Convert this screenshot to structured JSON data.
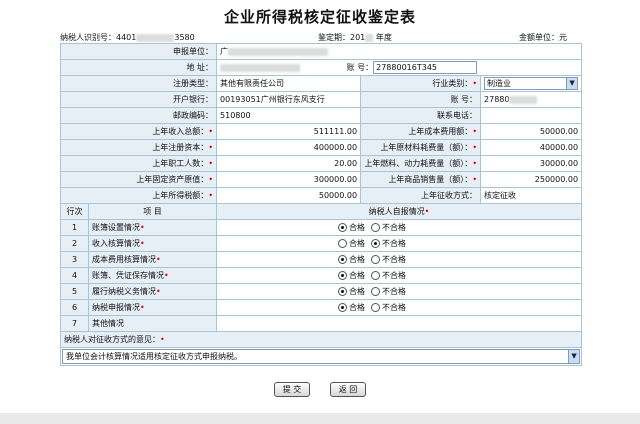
{
  "title": "企业所得税核定征收鉴定表",
  "meta": {
    "taxpayer_id_label": "纳税人识别号：",
    "taxpayer_id_prefix": "4401",
    "taxpayer_id_suffix": "3580",
    "period_label": "鉴定期：",
    "period_value": "201",
    "period_unit": "年度",
    "unit_label": "金额单位：元"
  },
  "rows": {
    "applicant_label": "申报单位：",
    "applicant_value": "广",
    "address_label": "地    址：",
    "account_label": "账  号：",
    "account_value": "27880016T345",
    "reg_type_label": "注册类型：",
    "reg_type_value": "其他有限责任公司",
    "industry_label": "行业类别：",
    "industry_value": "制造业",
    "bank_label": "开户银行：",
    "bank_value": "00193051广州银行东风支行",
    "account2_label": "账  号：",
    "account2_value": "27880",
    "postcode_label": "邮政编码：",
    "postcode_value": "510800",
    "phone_label": "联系电话："
  },
  "financials": [
    {
      "left_label": "上年收入总额：",
      "left_value": "511111.00",
      "right_label": "上年成本费用额：",
      "right_value": "50000.00"
    },
    {
      "left_label": "上年注册资本：",
      "left_value": "400000.00",
      "right_label": "上年原材料耗费量（额）：",
      "right_value": "40000.00"
    },
    {
      "left_label": "上年职工人数：",
      "left_value": "20.00",
      "right_label": "上年燃料、动力耗费量（额）：",
      "right_value": "30000.00"
    },
    {
      "left_label": "上年固定资产原值：",
      "left_value": "300000.00",
      "right_label": "上年商品销售量（额）：",
      "right_value": "250000.00"
    }
  ],
  "last_row": {
    "left_label": "上年所得税额：",
    "left_value": "50000.00",
    "right_label": "上年征收方式：",
    "right_value": "核定征收"
  },
  "check_header": {
    "index": "行次",
    "item": "项    目",
    "self_check": "纳税人自报情况"
  },
  "option_labels": {
    "pass": "合格",
    "fail": "不合格"
  },
  "check_items": [
    {
      "index": "1",
      "label": "账簿设置情况",
      "selected": "pass"
    },
    {
      "index": "2",
      "label": "收入核算情况",
      "selected": "fail"
    },
    {
      "index": "3",
      "label": "成本费用核算情况",
      "selected": "pass"
    },
    {
      "index": "4",
      "label": "账簿、凭证保存情况",
      "selected": "pass"
    },
    {
      "index": "5",
      "label": "履行纳税义务情况",
      "selected": "pass"
    },
    {
      "index": "6",
      "label": "纳税申报情况",
      "selected": "pass"
    }
  ],
  "other": {
    "index": "7",
    "label": "其他情况"
  },
  "opinion": {
    "label": "纳税人对征收方式的意见：",
    "value": "我单位会计核算情况适用核定征收方式申报纳税。"
  },
  "buttons": {
    "submit": "提 交",
    "back": "返 回"
  },
  "colors": {
    "required": "#d00000",
    "label_bg": "#e6eef6",
    "border": "#a9c4d8"
  }
}
